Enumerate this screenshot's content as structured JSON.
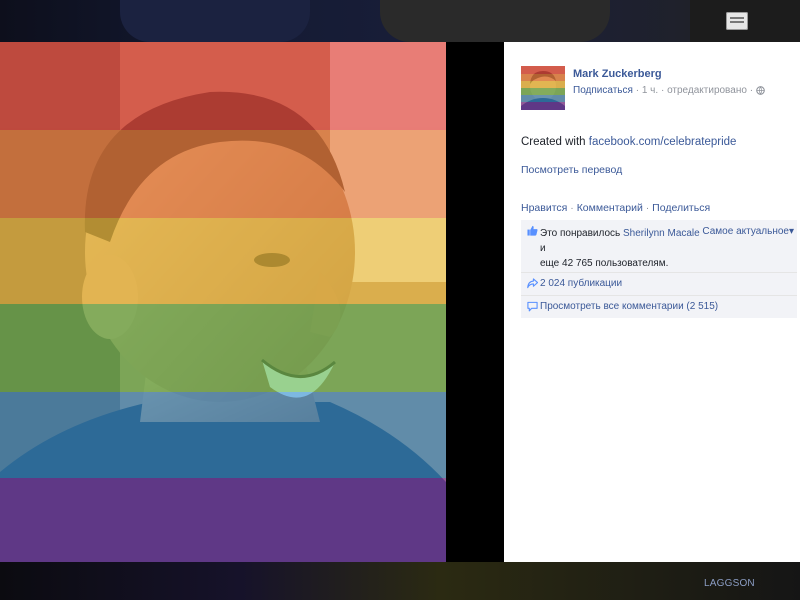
{
  "post": {
    "author": "Mark Zuckerberg",
    "subscribe_label": "Подписаться",
    "time": "1 ч.",
    "edited_label": "отредактировано",
    "separator": "·",
    "caption_prefix": "Created with",
    "caption_link": "facebook.com/celebratepride",
    "translate_label": "Посмотреть перевод"
  },
  "actions": {
    "like": "Нравится",
    "comment": "Комментарий",
    "share": "Поделиться"
  },
  "ufi": {
    "likes_prefix": "Это понравилось",
    "likes_name": "Sherilynn Macale",
    "likes_and": "и",
    "likes_rest": "еще 42 765 пользователям.",
    "sort_label": "Самое актуальное",
    "sort_arrow": "▾",
    "shares": "2 024 публикации",
    "comments": "Просмотреть все комментарии (2 515)"
  },
  "background": {
    "bottom_link": "LAGGSON"
  },
  "icons": {
    "close": "close-icon",
    "globe": "globe-icon",
    "like": "thumbs-up-icon",
    "share": "share-arrow-icon",
    "comment": "speech-bubble-icon"
  },
  "colors": {
    "link": "#3b5998",
    "meta": "#90949c",
    "panel_bg": "#ffffff",
    "ufi_bg": "#f2f3f7",
    "rainbow": [
      "#e8403a",
      "#f07d3a",
      "#f2c43b",
      "#5bb64b",
      "#2f8ed0",
      "#7f3fb5"
    ]
  }
}
